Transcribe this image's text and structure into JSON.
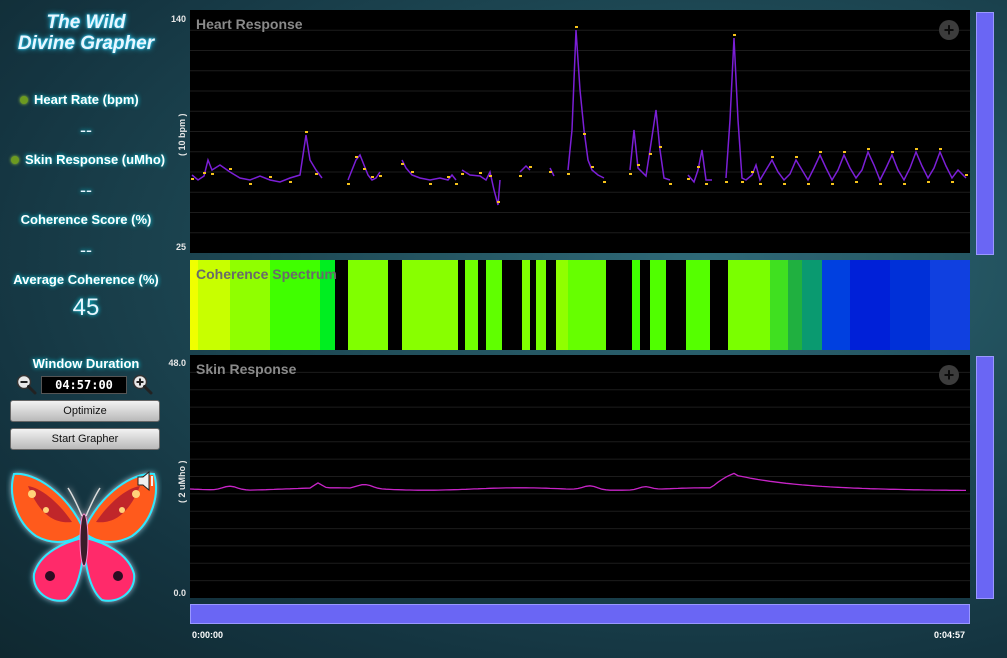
{
  "app": {
    "title_line1": "The Wild",
    "title_line2": "Divine Grapher"
  },
  "sidebar": {
    "heart_label": "Heart Rate (bpm)",
    "heart_value": "--",
    "skin_label": "Skin Response (uMho)",
    "skin_value": "--",
    "coherence_label": "Coherence Score (%)",
    "coherence_value": "--",
    "avg_label": "Average Coherence (%)",
    "avg_value": "45",
    "window_label": "Window Duration",
    "window_value": "04:57:00",
    "optimize_label": "Optimize",
    "start_label": "Start Grapher",
    "sound_icon": "speaker-icon"
  },
  "heart": {
    "title": "Heart Response",
    "y_max_label": "140",
    "y_min_label": "25",
    "unit_label": "( 10 bpm )",
    "plus": "+",
    "series_color": "#7b1fd6",
    "beat_marker_color": "#f5c21a"
  },
  "coherence": {
    "title": "Coherence Spectrum",
    "colors": [
      "#e6ff00",
      "#00e000",
      "#0020e0"
    ]
  },
  "skin": {
    "title": "Skin Response",
    "y_max_label": "48.0",
    "y_min_label": "0.0",
    "unit_label": "( 2 uMho )",
    "plus": "+",
    "series_color": "#c724c7"
  },
  "timeline": {
    "start_label": "0:00:00",
    "end_label": "0:04:57"
  },
  "colors": {
    "scroll_bar": "#6a66f4",
    "accent_glow": "#2ad4ff"
  }
}
